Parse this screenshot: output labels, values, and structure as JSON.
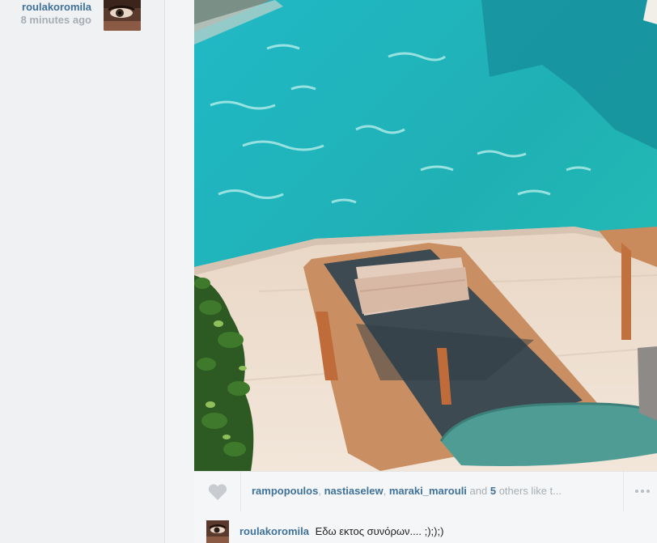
{
  "post": {
    "author": "roulakoromila",
    "time": "8 minutes ago",
    "likes": {
      "names": [
        "rampopoulos",
        "nastiaselew",
        "maraki_marouli"
      ],
      "separator": ", ",
      "and_text": " and ",
      "others_count": "5",
      "others_suffix": " others like t..."
    },
    "caption": {
      "author": "roulakoromila",
      "text": "Εδω εκτος συνόρων.... ;););)"
    }
  },
  "icons": {
    "like": "heart-icon",
    "more": "more-options-icon"
  },
  "colors": {
    "username": "#3f729b",
    "muted": "#a6aeb4",
    "pool_water": "#1fb3b7"
  }
}
